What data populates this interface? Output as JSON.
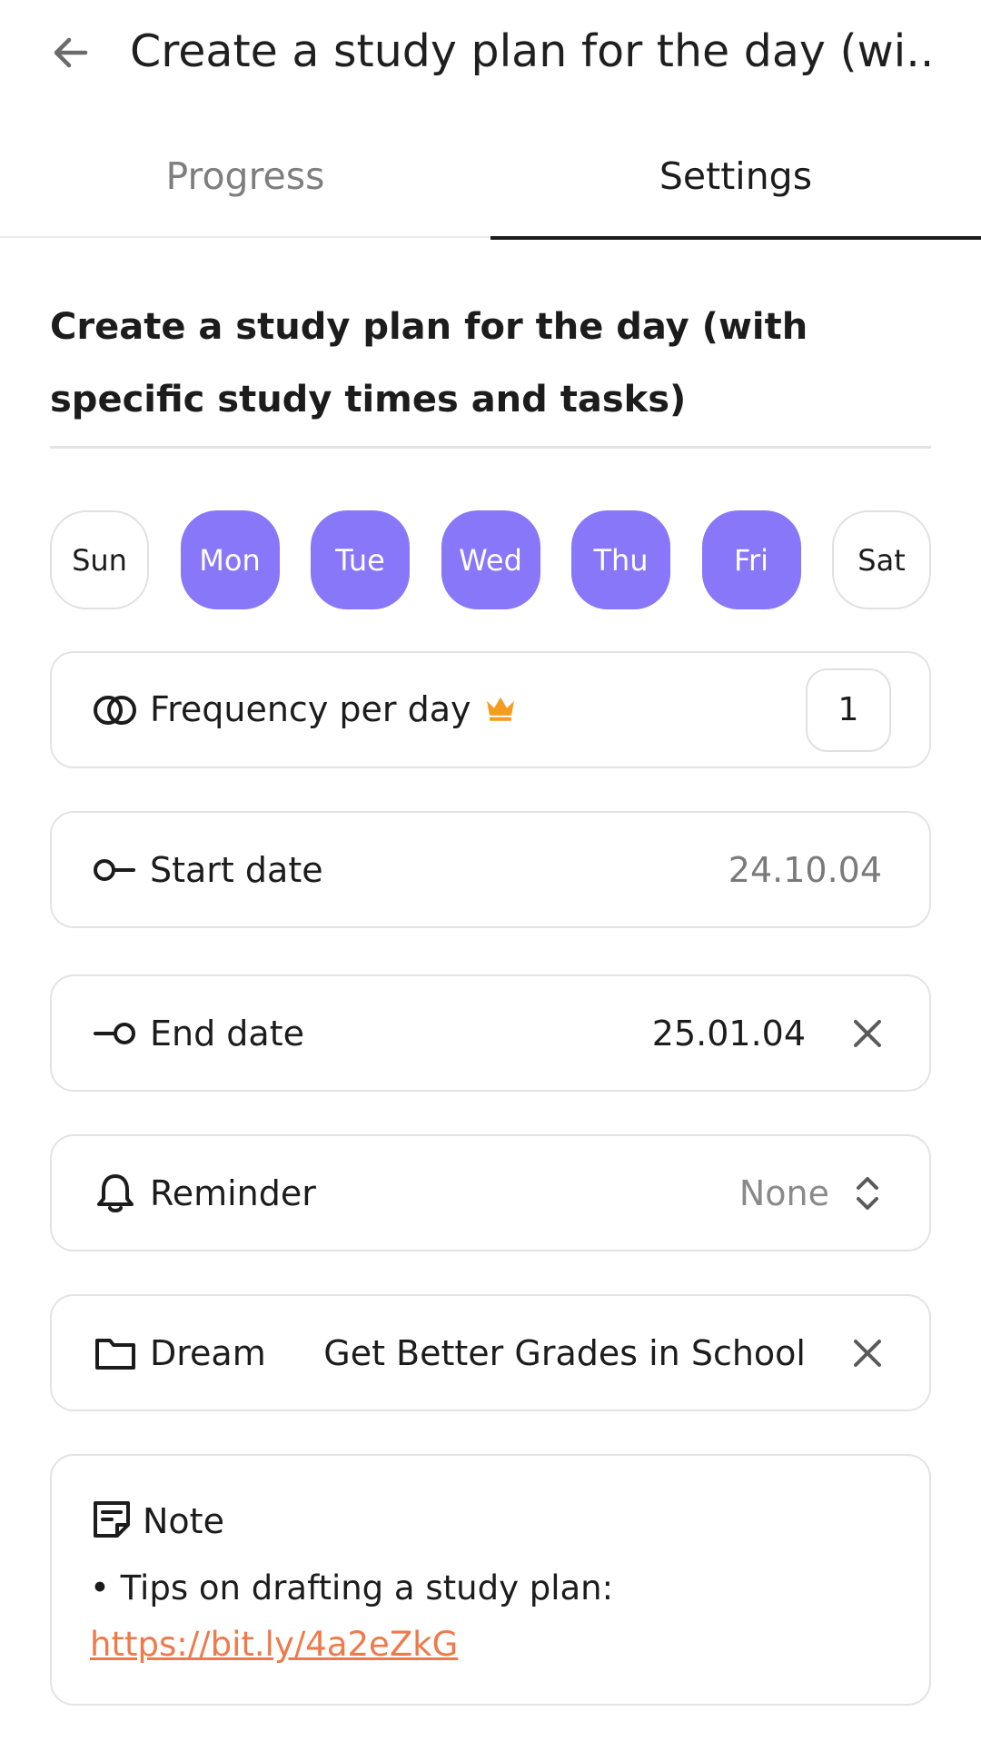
{
  "header": {
    "title": "Create a study plan for the day (wi..."
  },
  "tabs": [
    {
      "label": "Progress",
      "active": false
    },
    {
      "label": "Settings",
      "active": true
    }
  ],
  "plan": {
    "title": "Create a study plan for the day (with specific study times and tasks)"
  },
  "days": [
    {
      "label": "Sun",
      "selected": false
    },
    {
      "label": "Mon",
      "selected": true
    },
    {
      "label": "Tue",
      "selected": true
    },
    {
      "label": "Wed",
      "selected": true
    },
    {
      "label": "Thu",
      "selected": true
    },
    {
      "label": "Fri",
      "selected": true
    },
    {
      "label": "Sat",
      "selected": false
    }
  ],
  "frequency": {
    "label": "Frequency per day",
    "value": "1",
    "premium_icon": "crown-icon"
  },
  "start_date": {
    "label": "Start date",
    "value": "24.10.04"
  },
  "end_date": {
    "label": "End date",
    "value": "25.01.04"
  },
  "reminder": {
    "label": "Reminder",
    "value": "None"
  },
  "dream": {
    "label": "Dream",
    "value": "Get Better Grades in School"
  },
  "note": {
    "label": "Note",
    "text": "• Tips on drafting a study plan:",
    "link": "https://bit.ly/4a2eZkG"
  },
  "colors": {
    "accent": "#8877f8",
    "link": "#ee7a4a",
    "crown": "#f39c1f"
  }
}
